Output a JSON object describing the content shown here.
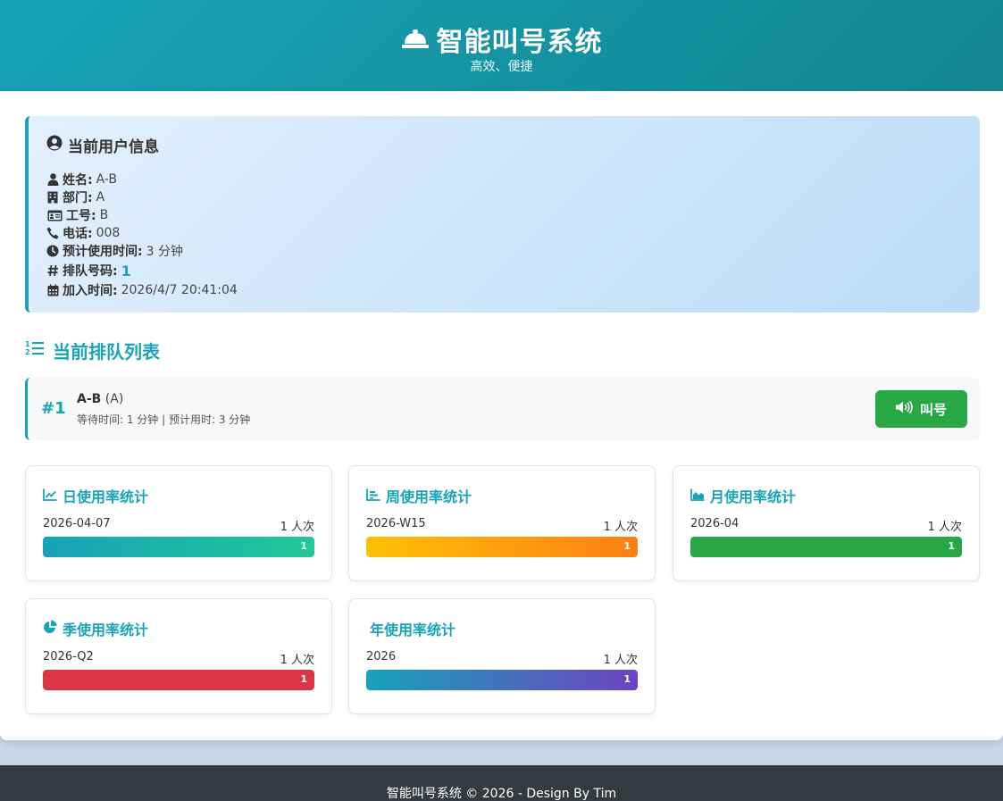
{
  "header": {
    "title": "智能叫号系统",
    "subtitle": "高效、便捷",
    "icon": "bell-icon"
  },
  "user_info": {
    "title": "当前用户信息",
    "rows": [
      {
        "icon": "user-icon",
        "label": "姓名:",
        "value": "A-B"
      },
      {
        "icon": "building-icon",
        "label": "部门:",
        "value": "A"
      },
      {
        "icon": "id-card-icon",
        "label": "工号:",
        "value": "B"
      },
      {
        "icon": "phone-icon",
        "label": "电话:",
        "value": "008"
      },
      {
        "icon": "clock-icon",
        "label": "预计使用时间:",
        "value": "3 分钟"
      },
      {
        "icon": "hash-icon",
        "label": "排队号码:",
        "value": "1"
      },
      {
        "icon": "calendar-icon",
        "label": "加入时间:",
        "value": "2026/4/7 20:41:04"
      }
    ]
  },
  "queue": {
    "title": "当前排队列表",
    "items": [
      {
        "number": "#1",
        "name": "A-B",
        "dept": "(A)",
        "meta": "等待时间: 1 分钟 | 预计用时: 3 分钟",
        "call_label": "叫号"
      }
    ]
  },
  "stats": [
    {
      "title": "日使用率统计",
      "icon": "line-chart-icon",
      "label": "2026-04-07",
      "count": "1 人次",
      "value": "1",
      "fill": 1.0,
      "colors": [
        "#17a2b8",
        "#20c997"
      ]
    },
    {
      "title": "周使用率统计",
      "icon": "bar-chart-icon",
      "label": "2026-W15",
      "count": "1 人次",
      "value": "1",
      "fill": 1.0,
      "colors": [
        "#ffc107",
        "#fd7e14"
      ]
    },
    {
      "title": "月使用率统计",
      "icon": "area-chart-icon",
      "label": "2026-04",
      "count": "1 人次",
      "value": "1",
      "fill": 1.0,
      "colors": [
        "#28a745",
        "#28a745"
      ]
    },
    {
      "title": "季使用率统计",
      "icon": "pie-chart-icon",
      "label": "2026-Q2",
      "count": "1 人次",
      "value": "1",
      "fill": 1.0,
      "colors": [
        "#dc3545",
        "#dc3545"
      ]
    },
    {
      "title": "年使用率统计",
      "icon": "",
      "label": "2026",
      "count": "1 人次",
      "value": "1",
      "fill": 1.0,
      "colors": [
        "#17a2b8",
        "#6f42c1"
      ]
    }
  ],
  "footer": {
    "text": "智能叫号系统 © 2026 - Design By Tim"
  },
  "colors": {
    "primary": "#18a3b8",
    "call_button": "#28a745",
    "footer_bg": "#343a40"
  }
}
